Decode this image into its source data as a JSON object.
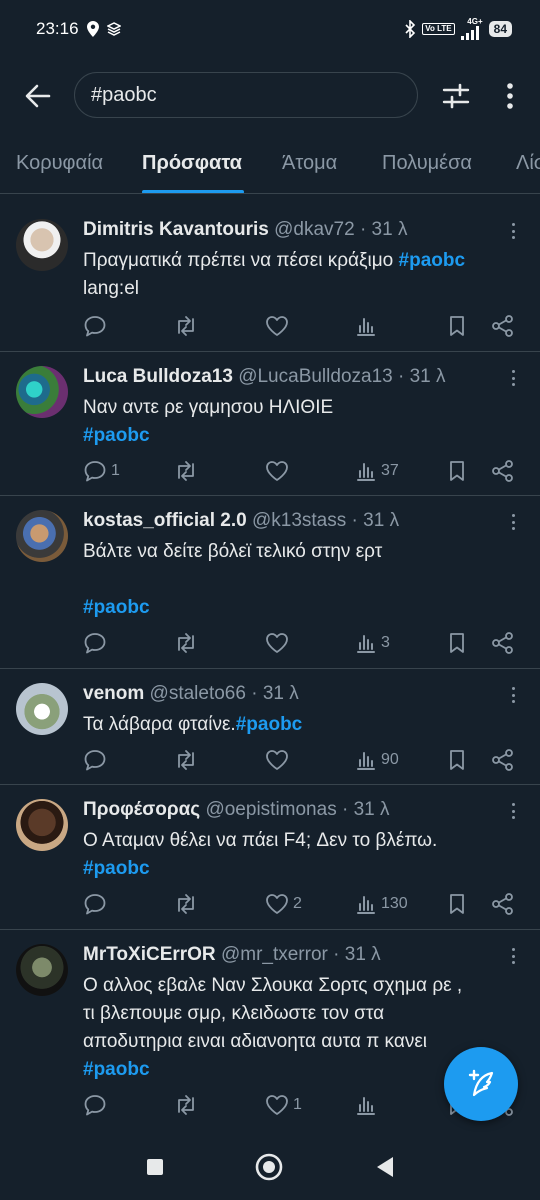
{
  "status_bar": {
    "time": "23:16",
    "volte": "Vo LTE",
    "network": "4G+",
    "battery": "84"
  },
  "search": {
    "query": "#paobc"
  },
  "tabs": [
    {
      "label": "Κορυφαία",
      "active": false
    },
    {
      "label": "Πρόσφατα",
      "active": true
    },
    {
      "label": "Άτομα",
      "active": false
    },
    {
      "label": "Πολυμέσα",
      "active": false
    },
    {
      "label": "Λίστες",
      "active": false
    }
  ],
  "tweets": [
    {
      "name": "Dimitris Kavantouris",
      "handle": "@dkav72",
      "time": "· 31 λ",
      "lines": [
        "Πραγματικά πρέπει να πέσει κράξιμο ",
        "lang:el"
      ],
      "hashtag_inline": "#paobc",
      "replies": "",
      "likes": "",
      "views": ""
    },
    {
      "name": "Luca Bulldoza13",
      "handle": "@LucaBulldoza13",
      "time": "· 31 λ",
      "lines": [
        "Ναν αντε ρε γαμησου ΗΛΙΘΙΕ"
      ],
      "hashtag_line": "#paobc",
      "replies": "1",
      "likes": "",
      "views": "37"
    },
    {
      "name": "kostas_official 2.0",
      "handle": "@k13stass",
      "time": "· 31 λ",
      "lines": [
        "Βάλτε να δείτε βόλεϊ τελικό στην ερτ",
        ""
      ],
      "hashtag_line": "#paobc",
      "replies": "",
      "likes": "",
      "views": "3"
    },
    {
      "name": "venom",
      "handle": "@staleto66",
      "time": "· 31 λ",
      "lines": [
        "Τα λάβαρα φταίνε."
      ],
      "hashtag_inline": "#paobc",
      "replies": "",
      "likes": "",
      "views": "90"
    },
    {
      "name": "Προφέσορας",
      "handle": "@oepistimonas",
      "time": "· 31 λ",
      "lines": [
        "Ο Αταμαν θέλει να πάει F4; Δεν το βλέπω."
      ],
      "hashtag_line": "#paobc",
      "replies": "",
      "likes": "2",
      "views": "130"
    },
    {
      "name": "MrToXiCErrOR",
      "handle": "@mr_txerror",
      "time": "· 31 λ",
      "lines": [
        "Ο αλλος εβαλε Ναν Σλουκα Σορτς σχημα ρε ,",
        "τι βλεπουμε σμρ, κλειδωστε τον στα",
        "αποδυτηρια ειναι αδιανοητα αυτα π κανει"
      ],
      "hashtag_line": "#paobc",
      "replies": "",
      "likes": "1",
      "views": ""
    }
  ],
  "colors": {
    "background": "#15202b",
    "accent": "#1d9bf0",
    "muted": "#8b98a5",
    "text": "#e7e9ea"
  },
  "icons": {
    "back": "arrow-left-icon",
    "filter": "sliders-icon",
    "more": "more-vertical-icon",
    "reply": "reply-icon",
    "retweet": "retweet-icon",
    "like": "heart-icon",
    "views": "views-icon",
    "bookmark": "bookmark-icon",
    "share": "share-icon",
    "compose": "feather-plus-icon"
  }
}
